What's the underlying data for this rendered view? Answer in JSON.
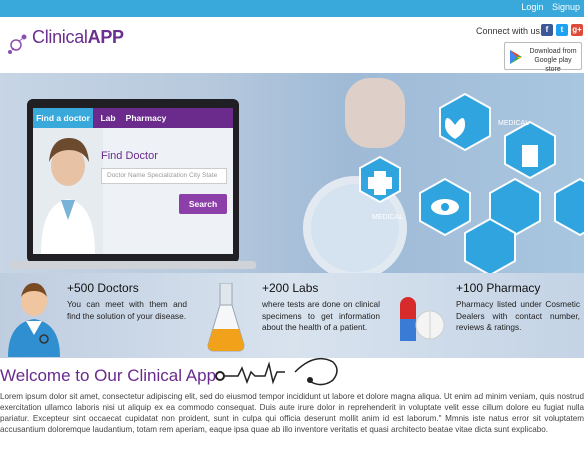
{
  "topbar": {
    "login": "Login",
    "signup": "Signup"
  },
  "brand": {
    "logo_prefix": "Clinical",
    "logo_suffix": "APP"
  },
  "header": {
    "connect_label": "Connect with us:",
    "social": [
      "f",
      "t",
      "g+"
    ],
    "google_play_line1": "Download from",
    "google_play_line2": "Google play store"
  },
  "hero": {
    "tabs": [
      {
        "label": "Find a doctor",
        "active": true
      },
      {
        "label": "Lab",
        "active": false
      },
      {
        "label": "Pharmacy",
        "active": false
      }
    ],
    "find_title": "Find Doctor",
    "search_placeholder": "Doctor Name Specialization City State",
    "search_button": "Search",
    "hex_label_1": "MEDICAL",
    "hex_label_2": "MEDICAL"
  },
  "stats": [
    {
      "title": "+500 Doctors",
      "text": "You can meet with them and find the solution of your disease."
    },
    {
      "title": "+200 Labs",
      "text": "where tests are done on clinical specimens to get information about the health of a patient."
    },
    {
      "title": "+100 Pharmacy",
      "text": "Pharmacy listed under Cosmetic Dealers with contact number, reviews & ratings."
    }
  ],
  "welcome": {
    "title": "Welcome to Our Clinical App",
    "body": "Lorem ipsum dolor sit amet, consectetur adipiscing elit, sed do eiusmod tempor incididunt ut labore et dolore magna aliqua. Ut enim ad minim veniam, quis nostrud exercitation ullamco laboris nisi ut aliquip ex ea commodo consequat. Duis aute irure dolor in reprehenderit in voluptate velit esse cillum dolore eu fugiat nulla pariatur. Excepteur sint occaecat cupidatat non proident, sunt in culpa qui officia deserunt mollit anim id est laborum.\" Mmnis iste natus error sit voluptatem accusantium doloremque laudantium, totam rem aperiam, eaque ipsa quae ab illo inventore veritatis et quasi architecto beatae vitae dicta sunt explicabo."
  },
  "colors": {
    "accent_blue": "#39a9dc",
    "brand_purple": "#6a2b8c",
    "button_purple": "#8c3fa8"
  }
}
